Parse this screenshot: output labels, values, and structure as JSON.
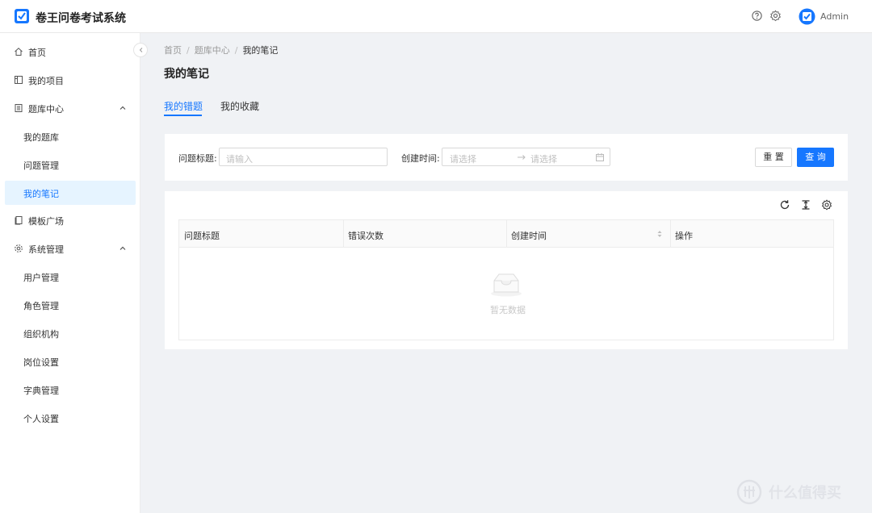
{
  "header": {
    "app_title": "卷王问卷考试系统",
    "user_name": "Admin",
    "icons": [
      "help-icon",
      "settings-icon"
    ]
  },
  "sidebar": {
    "items": [
      {
        "label": "首页",
        "icon": "home-icon"
      },
      {
        "label": "我的项目",
        "icon": "project-icon"
      },
      {
        "label": "题库中心",
        "icon": "question-bank-icon",
        "expanded": true,
        "children": [
          {
            "label": "我的题库"
          },
          {
            "label": "问题管理"
          },
          {
            "label": "我的笔记",
            "active": true
          }
        ]
      },
      {
        "label": "模板广场",
        "icon": "template-icon"
      },
      {
        "label": "系统管理",
        "icon": "system-icon",
        "expanded": true,
        "children": [
          {
            "label": "用户管理"
          },
          {
            "label": "角色管理"
          },
          {
            "label": "组织机构"
          },
          {
            "label": "岗位设置"
          },
          {
            "label": "字典管理"
          },
          {
            "label": "个人设置"
          }
        ]
      }
    ]
  },
  "breadcrumb": [
    "首页",
    "题库中心",
    "我的笔记"
  ],
  "page_title": "我的笔记",
  "tabs": [
    {
      "label": "我的错题",
      "active": true
    },
    {
      "label": "我的收藏"
    }
  ],
  "search": {
    "title_label": "问题标题:",
    "title_placeholder": "请输入",
    "time_label": "创建时间:",
    "start_placeholder": "请选择",
    "end_placeholder": "请选择",
    "reset_label": "重 置",
    "query_label": "查 询"
  },
  "table": {
    "columns": [
      "问题标题",
      "错误次数",
      "创建时间",
      "操作"
    ],
    "sortable_column": "创建时间",
    "empty_text": "暂无数据",
    "toolbar_icons": [
      "reload-icon",
      "density-icon",
      "column-settings-icon"
    ]
  },
  "watermark": {
    "text": "什么值得买"
  },
  "colors": {
    "primary": "#1677ff",
    "active_bg": "#e6f4ff",
    "bg": "#f0f2f5"
  }
}
